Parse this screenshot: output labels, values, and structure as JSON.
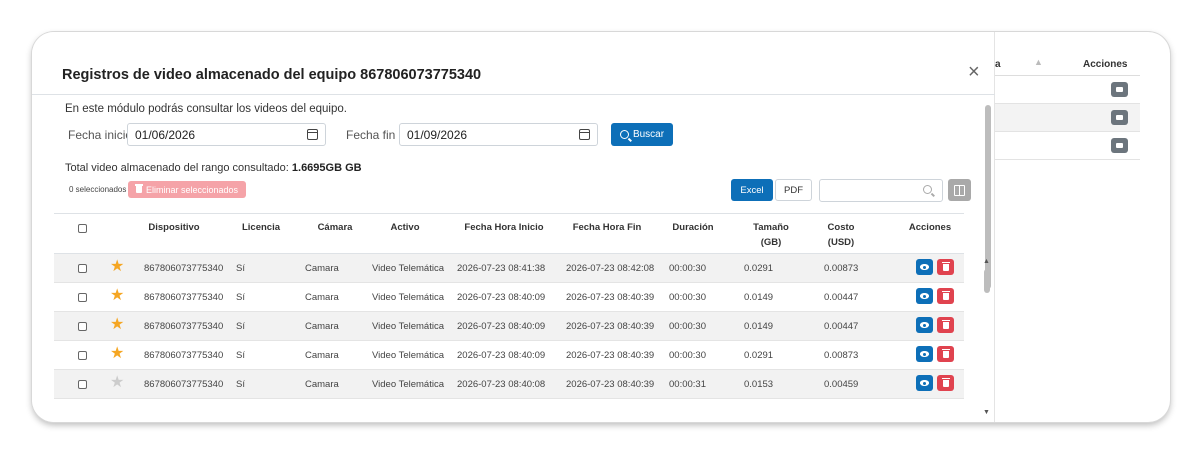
{
  "background_table": {
    "header_partial": "a",
    "header_actions": "Acciones",
    "rows": 3
  },
  "modal": {
    "title": "Registros de video almacenado del equipo 867806073775340",
    "close_glyph": "×",
    "intro": "En este módulo podrás consultar los videos del equipo.",
    "start_label": "Fecha inicio",
    "start_value": "01/06/2026",
    "end_label": "Fecha fin",
    "end_value": "01/09/2026",
    "search_label": "Buscar",
    "total_prefix": "Total video almacenado del rango consultado:",
    "total_value": "1.6695GB GB",
    "selected_count": "0 seleccionados",
    "delete_selected_label": "Eliminar seleccionados",
    "excel_label": "Excel",
    "pdf_label": "PDF",
    "table_search_placeholder": ""
  },
  "table": {
    "headers": {
      "device": "Dispositivo",
      "license": "Licencia",
      "camera": "Cámara",
      "active": "Activo",
      "start": "Fecha Hora Inicio",
      "end": "Fecha Hora Fin",
      "duration": "Duración",
      "size_1": "Tamaño",
      "size_2": "(GB)",
      "cost_1": "Costo",
      "cost_2": "(USD)",
      "actions": "Acciones"
    },
    "rows": [
      {
        "starred": true,
        "device": "867806073775340",
        "license": "Sí",
        "camera": "Camara",
        "active": "Video Telemática",
        "start": "2026-07-23 08:41:38",
        "end": "2026-07-23 08:42:08",
        "duration": "00:00:30",
        "size": "0.0291",
        "cost": "0.00873"
      },
      {
        "starred": true,
        "device": "867806073775340",
        "license": "Sí",
        "camera": "Camara",
        "active": "Video Telemática",
        "start": "2026-07-23 08:40:09",
        "end": "2026-07-23 08:40:39",
        "duration": "00:00:30",
        "size": "0.0149",
        "cost": "0.00447"
      },
      {
        "starred": true,
        "device": "867806073775340",
        "license": "Sí",
        "camera": "Camara",
        "active": "Video Telemática",
        "start": "2026-07-23 08:40:09",
        "end": "2026-07-23 08:40:39",
        "duration": "00:00:30",
        "size": "0.0149",
        "cost": "0.00447"
      },
      {
        "starred": true,
        "device": "867806073775340",
        "license": "Sí",
        "camera": "Camara",
        "active": "Video Telemática",
        "start": "2026-07-23 08:40:09",
        "end": "2026-07-23 08:40:39",
        "duration": "00:00:30",
        "size": "0.0291",
        "cost": "0.00873"
      },
      {
        "starred": false,
        "device": "867806073775340",
        "license": "Sí",
        "camera": "Camara",
        "active": "Video Telemática",
        "start": "2026-07-23 08:40:08",
        "end": "2026-07-23 08:40:39",
        "duration": "00:00:31",
        "size": "0.0153",
        "cost": "0.00459"
      }
    ]
  },
  "colors": {
    "primary": "#0d6fb8",
    "danger": "#e0434f",
    "danger_light": "#f5a3a8",
    "star_on": "#f5a623",
    "star_off": "#cccccc"
  },
  "icons": {
    "close": "close-icon",
    "calendar": "calendar-icon",
    "search": "search-icon",
    "trash": "trash-icon",
    "star": "star-icon",
    "view": "eye-icon",
    "columns": "columns-icon",
    "folder": "folder-icon"
  }
}
